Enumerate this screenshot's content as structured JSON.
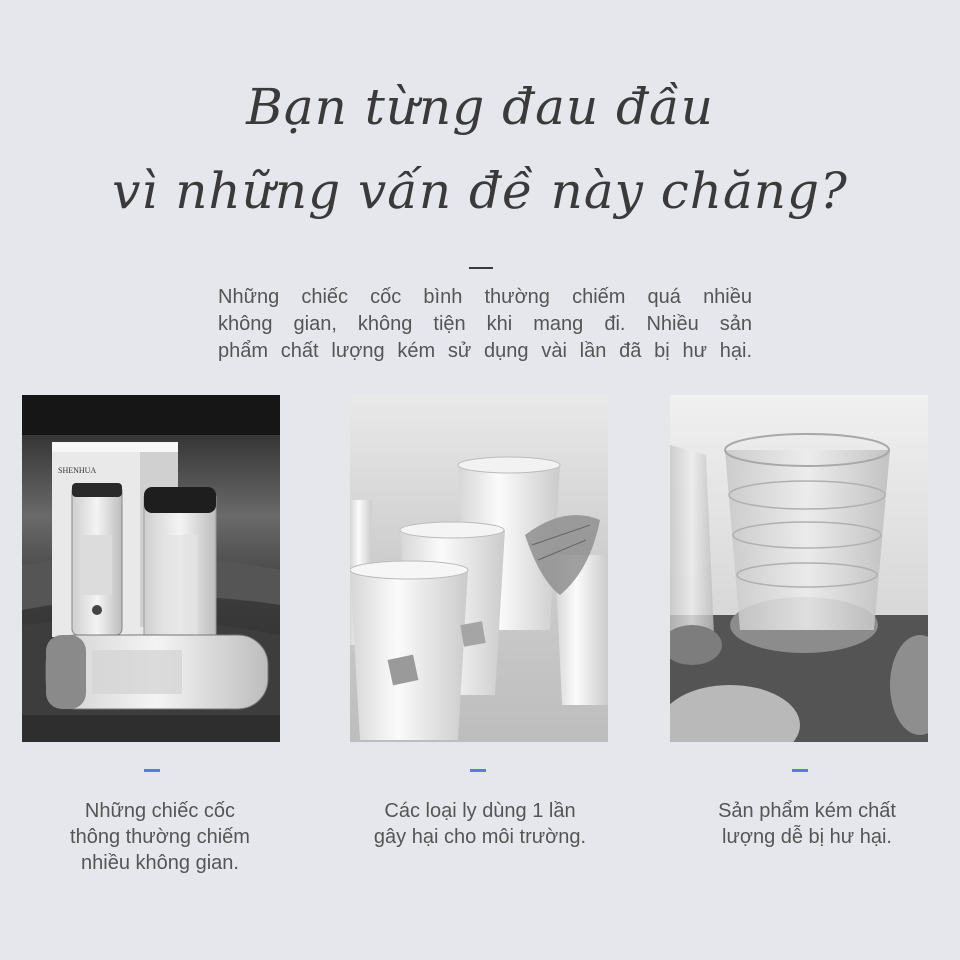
{
  "headline": {
    "line1": "Bạn từng đau đầu",
    "line2": "vì những vấn đề này chăng?"
  },
  "intro": {
    "lines": [
      "Những chiếc cốc bình thường chiếm quá nhiều",
      "không gian, không tiện khi mang đi. Nhiều sản",
      "phẩm chất lượng kém sử dụng vài lần đã bị hư hại."
    ]
  },
  "cards": [
    {
      "brand": "SHENHUA",
      "caption": [
        "Những chiếc cốc",
        "thông thường chiếm",
        "nhiều không gian."
      ]
    },
    {
      "caption": [
        "Các loại ly dùng 1 lần",
        "gây hại cho môi trường."
      ]
    },
    {
      "caption": [
        "Sản phẩm kém chất",
        "lượng dễ bị hư hại."
      ]
    }
  ],
  "colors": {
    "background": "#e6e7ec",
    "accent": "#5b7be0",
    "text": "#555555",
    "headline": "#3a3a3a"
  }
}
